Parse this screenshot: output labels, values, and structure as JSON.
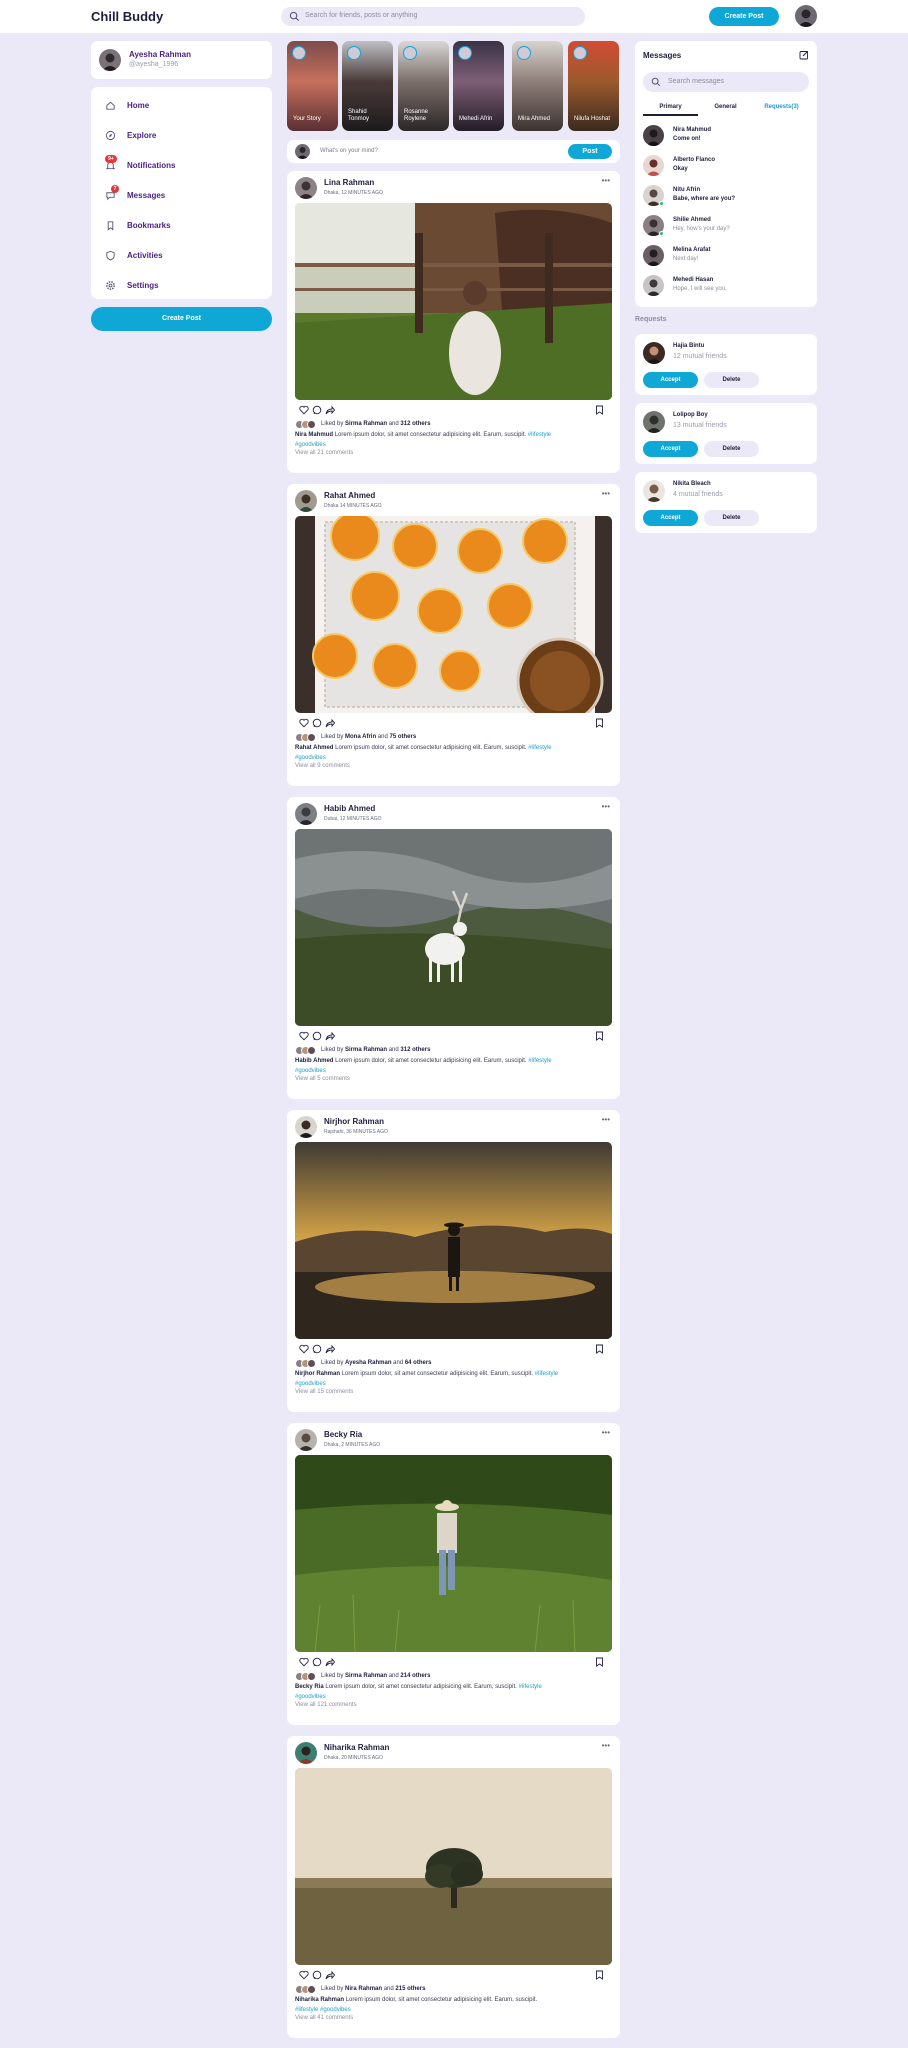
{
  "navbar": {
    "logo": "Chill Buddy",
    "search_placeholder": "Search for friends, posts or anything",
    "create_post": "Create Post"
  },
  "profile": {
    "name": "Ayesha Rahman",
    "handle": "@ayesha_1996"
  },
  "menu": [
    {
      "label": "Home",
      "icon": "home-icon"
    },
    {
      "label": "Explore",
      "icon": "compass-icon"
    },
    {
      "label": "Notifications",
      "icon": "bell-icon",
      "badge": "9+"
    },
    {
      "label": "Messages",
      "icon": "message-icon",
      "badge": "7"
    },
    {
      "label": "Bookmarks",
      "icon": "bookmark-icon"
    },
    {
      "label": "Activities",
      "icon": "activity-icon"
    },
    {
      "label": "Settings",
      "icon": "gear-icon"
    }
  ],
  "sidebar_create_post": "Create Post",
  "stories": [
    {
      "name": "Your Story"
    },
    {
      "name": "Shahid Tonmoy"
    },
    {
      "name": "Rosanne Roylene"
    },
    {
      "name": "Mehedi Afrin"
    },
    {
      "name": "Mira Ahmed"
    },
    {
      "name": "Nilufa Hoshat"
    }
  ],
  "composer": {
    "placeholder": "What's on your mind?",
    "post_label": "Post"
  },
  "posts": [
    {
      "author": "Lina Rahman",
      "location_time": "Dhaka, 12 MINUTES AGO",
      "liked_by": "Sirma Rahman",
      "others": "312 others",
      "caption_author": "Nira Mahmud",
      "caption": "Lorem ipsum dolor, sit amet consectetur adipisicing elit. Earum, suscipit.",
      "tag1": "#lifestyle",
      "tag2": "#goodvibes",
      "comments": "View all 21 comments"
    },
    {
      "author": "Rahat Ahmed",
      "location_time": "Dhaka 14 MINUTES AGO",
      "liked_by": "Mona Afrin",
      "others": "75 others",
      "caption_author": "Rahat Ahmed",
      "caption": "Lorem ipsum dolor, sit amet consectetur adipisicing elit. Earum, suscipit.",
      "tag1": "#lifestyle",
      "tag2": "#goodvibes",
      "comments": "View all 9 comments"
    },
    {
      "author": "Habib Ahmed",
      "location_time": "Dubai, 12 MINUTES AGO",
      "liked_by": "Sirma Rahman",
      "others": "312 others",
      "caption_author": "Habib Ahmed",
      "caption": "Lorem ipsum dolor, sit amet consectetur adipisicing elit. Earum, suscipit.",
      "tag1": "#lifestyle",
      "tag2": "#goodvibes",
      "comments": "View all 5 comments"
    },
    {
      "author": "Nirjhor Rahman",
      "location_time": "Rajshahi, 36 MINUTES AGO",
      "liked_by": "Ayesha Rahman",
      "others": "64 others",
      "caption_author": "Nirjhor Rahman",
      "caption": "Lorem ipsum dolor, sit amet consectetur adipisicing elit. Earum, suscipit.",
      "tag1": "#lifestyle",
      "tag2": "#goodvibes",
      "comments": "View all 15 comments"
    },
    {
      "author": "Becky Ria",
      "location_time": "Dhaka, 2 MINUTES AGO",
      "liked_by": "Sirma Rahman",
      "others": "214 others",
      "caption_author": "Becky Ria",
      "caption": "Lorem ipsum dolor, sit amet consectetur adipisicing elit. Earum, suscipit.",
      "tag1": "#lifestyle",
      "tag2": "#goodvibes",
      "comments": "View all 121 comments"
    },
    {
      "author": "Niharika Rahman",
      "location_time": "Dhaka, 20 MINUTES AGO",
      "liked_by": "Nira Rahman",
      "others": "215 others",
      "caption_author": "Niharika Rahman",
      "caption": "Lorem ipsum dolor, sit amet consectetur adipisicing elit. Earum, suscipit.",
      "tag1": "#lifestyle",
      "tag2": "#goodvibes",
      "comments": "View all 41 comments"
    }
  ],
  "messages": {
    "title": "Messages",
    "search_placeholder": "Search messages",
    "tabs": [
      "Primary",
      "General",
      "Requests(3)"
    ],
    "items": [
      {
        "name": "Nira Mahmud",
        "text": "Come on!",
        "unread": true
      },
      {
        "name": "Alberto Flanco",
        "text": "Okay",
        "unread": false
      },
      {
        "name": "Nitu Afrin",
        "text": "Babe, where are you?",
        "unread": true
      },
      {
        "name": "Shilie Ahmed",
        "text": "Hey, how's your day?",
        "unread": false
      },
      {
        "name": "Melina Arafat",
        "text": "Next day!",
        "unread": false
      },
      {
        "name": "Mehedi Hasan",
        "text": "Hope, I will see you.",
        "unread": false
      }
    ]
  },
  "requests": {
    "heading": "Requests",
    "accept_label": "Accept",
    "delete_label": "Delete",
    "items": [
      {
        "name": "Hajia Bintu",
        "mutual": "12 mutual friends"
      },
      {
        "name": "Lolipop Boy",
        "mutual": "13 mutual friends"
      },
      {
        "name": "Nikita Bleach",
        "mutual": "4 mutual friends"
      }
    ]
  },
  "colors": {
    "accent": "#0ea7d6",
    "menu_text": "#4a1f82",
    "background": "#ebe9f7"
  }
}
